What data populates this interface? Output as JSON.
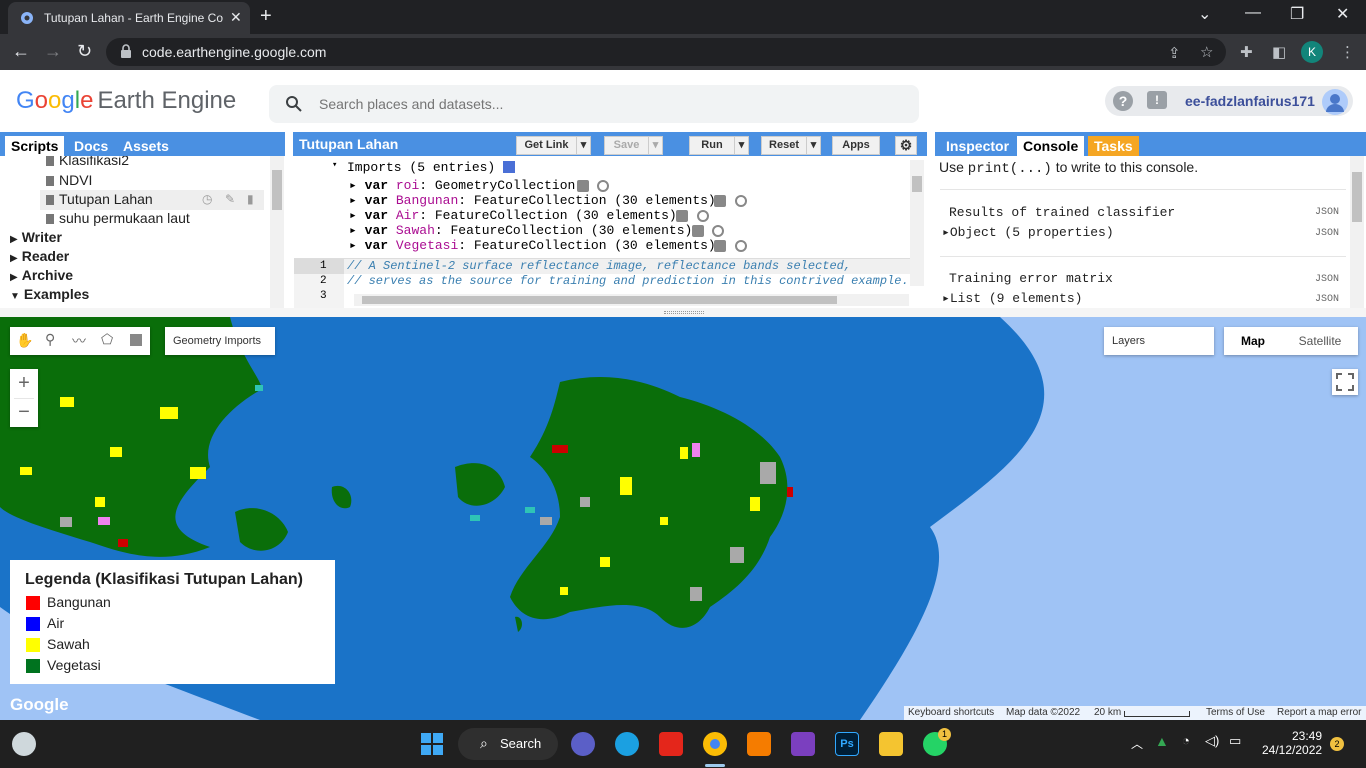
{
  "browser": {
    "tab_title": "Tutupan Lahan - Earth Engine Co",
    "url": "code.earthengine.google.com"
  },
  "header": {
    "logo_google": [
      "G",
      "o",
      "o",
      "g",
      "l",
      "e"
    ],
    "logo_product": "Earth Engine",
    "search_placeholder": "Search places and datasets...",
    "username": "ee-fadzlanfairus171",
    "help_glyph": "?",
    "feedback_glyph": "!"
  },
  "left_panel": {
    "tabs": [
      "Scripts",
      "Docs",
      "Assets"
    ],
    "scripts": [
      "Klasifikasi2",
      "NDVI",
      "Tutupan Lahan",
      "suhu permukaan laut"
    ],
    "folders": [
      "Writer",
      "Reader",
      "Archive",
      "Examples"
    ]
  },
  "editor": {
    "title": "Tutupan Lahan",
    "buttons": {
      "get_link": "Get Link",
      "save": "Save",
      "run": "Run",
      "reset": "Reset",
      "apps": "Apps"
    },
    "imports_header": "Imports (5 entries)",
    "imports": [
      {
        "name": "roi",
        "type": "GeometryCollection"
      },
      {
        "name": "Bangunan",
        "type": "FeatureCollection (30 elements)"
      },
      {
        "name": "Air",
        "type": "FeatureCollection (30 elements)"
      },
      {
        "name": "Sawah",
        "type": "FeatureCollection (30 elements)"
      },
      {
        "name": "Vegetasi",
        "type": "FeatureCollection (30 elements)"
      }
    ],
    "var_keyword": "var",
    "line_numbers": [
      "1",
      "2",
      "3"
    ],
    "code_lines": [
      "// A Sentinel-2 surface reflectance image, reflectance bands selected,",
      "// serves as the source for training and prediction in this contrived example."
    ]
  },
  "console": {
    "tabs": [
      "Inspector",
      "Console",
      "Tasks"
    ],
    "hint_prefix": "Use ",
    "hint_code": "print(...)",
    "hint_suffix": " to write to this console.",
    "entries": [
      {
        "title": "Results of trained classifier",
        "value": "Object (5 properties)"
      },
      {
        "title": "Training error matrix",
        "value": "List (9 elements)"
      }
    ],
    "json_label": "JSON"
  },
  "map": {
    "geometry_imports": "Geometry Imports",
    "layers": "Layers",
    "map_type_buttons": [
      "Map",
      "Satellite"
    ],
    "zoom_in": "+",
    "zoom_out": "−",
    "google_logo": "Google",
    "attribution": [
      "Keyboard shortcuts",
      "Map data ©2022",
      "20 km",
      "Terms of Use",
      "Report a map error"
    ]
  },
  "legend": {
    "title": "Legenda (Klasifikasi Tutupan Lahan)",
    "items": [
      {
        "label": "Bangunan",
        "color": "#ff0000"
      },
      {
        "label": "Air",
        "color": "#0000ff"
      },
      {
        "label": "Sawah",
        "color": "#ffff00"
      },
      {
        "label": "Vegetasi",
        "color": "#00731f"
      }
    ]
  },
  "colors": {
    "accent": "#4a90e2",
    "tasks_tab": "#f5a623",
    "sea": "#1a73c8",
    "vegetation": "#0a6e0a"
  },
  "taskbar": {
    "search_label": "Search",
    "time": "23:49",
    "date": "24/12/2022",
    "notification_count": "2",
    "whatsapp_badge": "1"
  }
}
